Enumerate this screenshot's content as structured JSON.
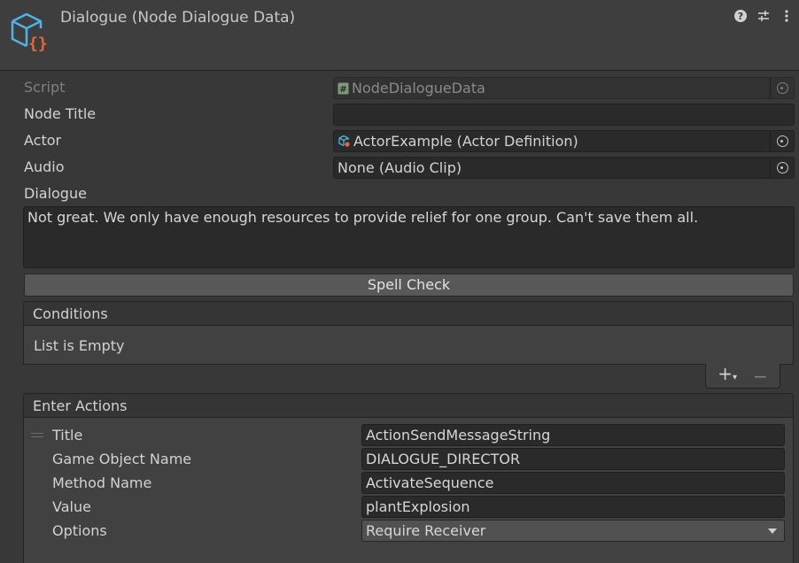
{
  "header": {
    "title": "Dialogue (Node Dialogue Data)",
    "icon": "scriptable-object-icon",
    "tools": [
      "help-icon",
      "preset-icon",
      "kebab-menu-icon"
    ]
  },
  "fields": {
    "script": {
      "label": "Script",
      "value": "NodeDialogueData"
    },
    "node_title": {
      "label": "Node Title",
      "value": ""
    },
    "actor": {
      "label": "Actor",
      "value": "ActorExample (Actor Definition)"
    },
    "audio": {
      "label": "Audio",
      "value": "None (Audio Clip)"
    },
    "dialogue": {
      "label": "Dialogue",
      "value": "Not great. We only have enough resources to provide relief for one group. Can't save them all."
    }
  },
  "spell_check": {
    "label": "Spell Check"
  },
  "conditions": {
    "header": "Conditions",
    "empty_text": "List is Empty",
    "add_label": "+",
    "add_dropdown_marker": "▾",
    "remove_label": "−"
  },
  "enter_actions": {
    "header": "Enter Actions",
    "item": {
      "title": {
        "label": "Title",
        "value": "ActionSendMessageString"
      },
      "game_object_name": {
        "label": "Game Object Name",
        "value": "DIALOGUE_DIRECTOR"
      },
      "method_name": {
        "label": "Method Name",
        "value": "ActivateSequence"
      },
      "value": {
        "label": "Value",
        "value": "plantExplosion"
      },
      "options": {
        "label": "Options",
        "value": "Require Receiver"
      }
    }
  },
  "colors": {
    "background": "#383838",
    "field_bg": "#2a2a2a",
    "button_bg": "#585858",
    "icon_blue": "#4fb3e8",
    "icon_orange": "#e8683a"
  }
}
